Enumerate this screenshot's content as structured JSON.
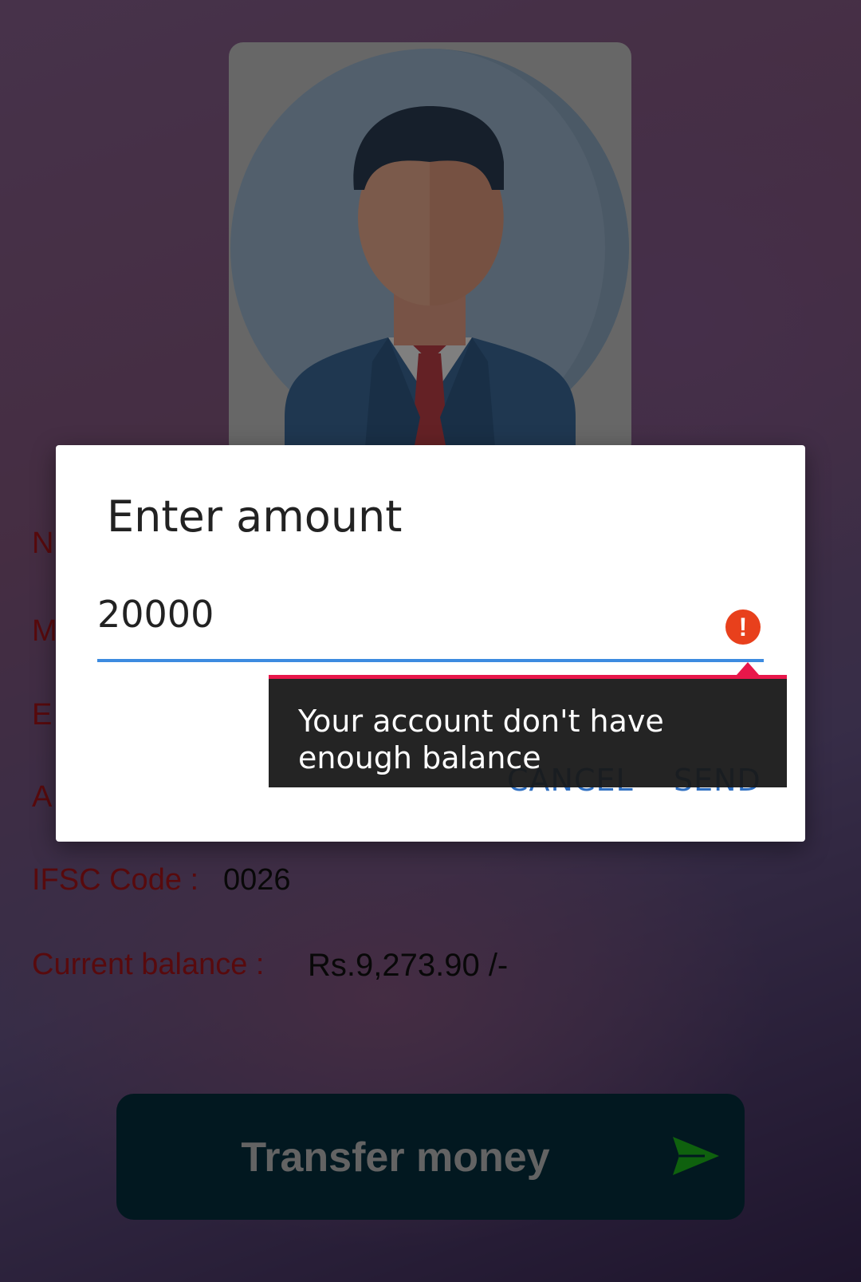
{
  "profile": {
    "avatar_icon": "businessman-avatar-icon"
  },
  "details": {
    "name_label": "N",
    "mobile_label": "M",
    "email_label": "E",
    "account_label": "A",
    "ifsc_label": "IFSC Code :",
    "ifsc_value": "0026",
    "balance_label": "Current balance :",
    "balance_value": "Rs.9,273.90 /-"
  },
  "transfer_button": {
    "label": "Transfer money",
    "icon": "send-icon"
  },
  "dialog": {
    "title": "Enter amount",
    "amount_value": "20000",
    "error_icon": "!",
    "error_message": "Your account don't have enough balance",
    "cancel_label": "CANCEL",
    "send_label": "SEND"
  },
  "colors": {
    "label_red": "#b0151b",
    "accent_blue": "#3d8be0",
    "error_red": "#e8401c",
    "button_dark": "#053040",
    "send_green": "#1fc31c"
  }
}
